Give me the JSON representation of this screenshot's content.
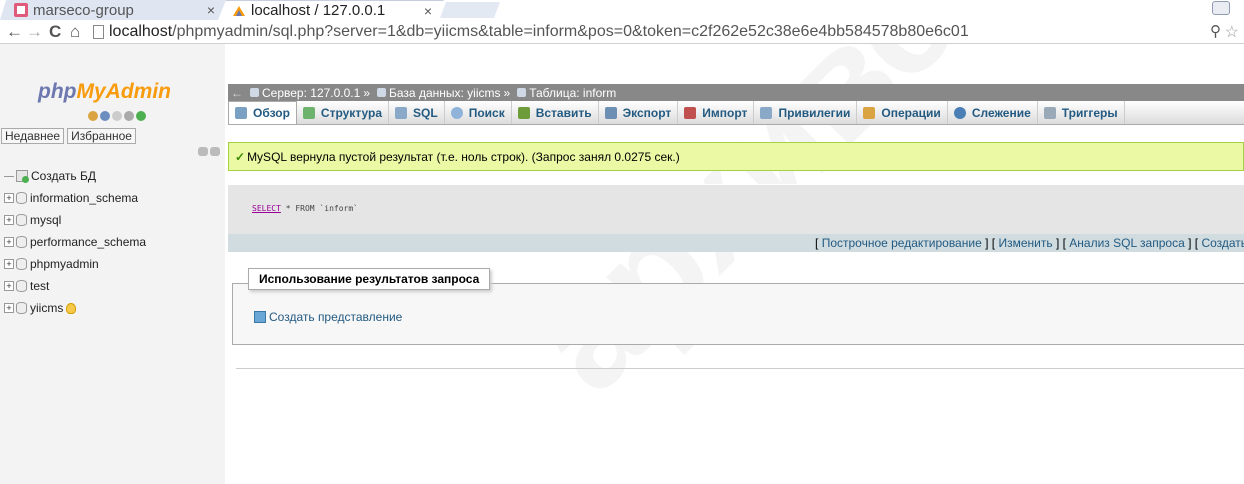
{
  "browser": {
    "tabs": [
      {
        "title": "marseco-group",
        "close": "×"
      },
      {
        "title": "localhost / 127.0.0.1",
        "close": "×"
      }
    ],
    "url_host": "localhost",
    "url_path": "/phpmyadmin/sql.php?server=1&db=yiicms&table=inform&pos=0&token=c2f262e52c38e6e4bb584578b80e6c01"
  },
  "sidebar": {
    "logo_left": "php",
    "logo_right": "MyAdmin",
    "recent_label": "Недавнее",
    "favorites_label": "Избранное",
    "tree": [
      {
        "label": "Создать БД",
        "kind": "new"
      },
      {
        "label": "information_schema",
        "kind": "db"
      },
      {
        "label": "mysql",
        "kind": "db"
      },
      {
        "label": "performance_schema",
        "kind": "db"
      },
      {
        "label": "phpmyadmin",
        "kind": "db"
      },
      {
        "label": "test",
        "kind": "db"
      },
      {
        "label": "yiicms",
        "kind": "db"
      }
    ]
  },
  "breadcrumb": {
    "server": "Сервер: 127.0.0.1",
    "database": "База данных: yiicms",
    "table": "Таблица: inform",
    "separator": "»"
  },
  "tabs": [
    {
      "label": "Обзор",
      "color": "#7aa0c4"
    },
    {
      "label": "Структура",
      "color": "#6db36d"
    },
    {
      "label": "SQL",
      "color": "#8aa8c8"
    },
    {
      "label": "Поиск",
      "color": "#8fb3d9"
    },
    {
      "label": "Вставить",
      "color": "#6f9c3a"
    },
    {
      "label": "Экспорт",
      "color": "#6d8fb3"
    },
    {
      "label": "Импорт",
      "color": "#c0504d"
    },
    {
      "label": "Привилегии",
      "color": "#8aa8c8"
    },
    {
      "label": "Операции",
      "color": "#d9a441"
    },
    {
      "label": "Слежение",
      "color": "#4a7fb5"
    },
    {
      "label": "Триггеры",
      "color": "#9aa9b8"
    }
  ],
  "message": {
    "text": "MySQL вернула пустой результат (т.е. ноль строк). (Запрос занял 0.0275 сек.)"
  },
  "query": {
    "keyword": "SELECT",
    "rest": " * FROM `inform`",
    "links": [
      "Построчное редактирование",
      "Изменить",
      "Анализ SQL запроса",
      "Создать PHP-код"
    ]
  },
  "results_ops": {
    "legend": "Использование результатов запроса",
    "create_view": "Создать представление"
  },
  "watermark": "архивсо"
}
